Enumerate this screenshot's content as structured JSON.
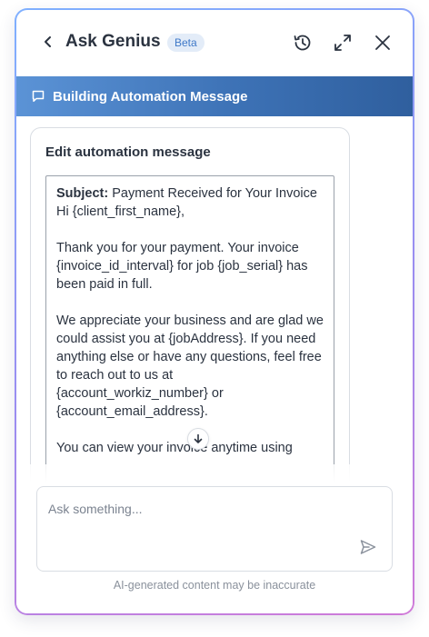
{
  "header": {
    "title": "Ask Genius",
    "badge": "Beta",
    "icons": [
      "chevron-left-icon",
      "history-icon",
      "expand-icon",
      "close-icon"
    ]
  },
  "banner": {
    "icon": "chat-bubble-icon",
    "label": "Building Automation Message"
  },
  "card": {
    "title": "Edit automation message",
    "message": {
      "subject_label": "Subject:",
      "subject_value": " Payment Received for Your Invoice",
      "greeting": "Hi {client_first_name},",
      "paragraph1": "Thank you for your payment. Your invoice {invoice_id_interval} for job {job_serial} has been paid in full.",
      "paragraph2": "We appreciate your business and are glad we could assist you at {jobAddress}. If you need anything else or have any questions, feel free to reach out to us at {account_workiz_number} or {account_email_address}.",
      "paragraph3": "You can view your invoice anytime using"
    }
  },
  "composer": {
    "placeholder": "Ask something...",
    "disclaimer": "AI-generated content may be inaccurate"
  },
  "colors": {
    "accent": "#3d72b6",
    "badge_bg": "#e3ecf8",
    "badge_text": "#3f79c8"
  }
}
